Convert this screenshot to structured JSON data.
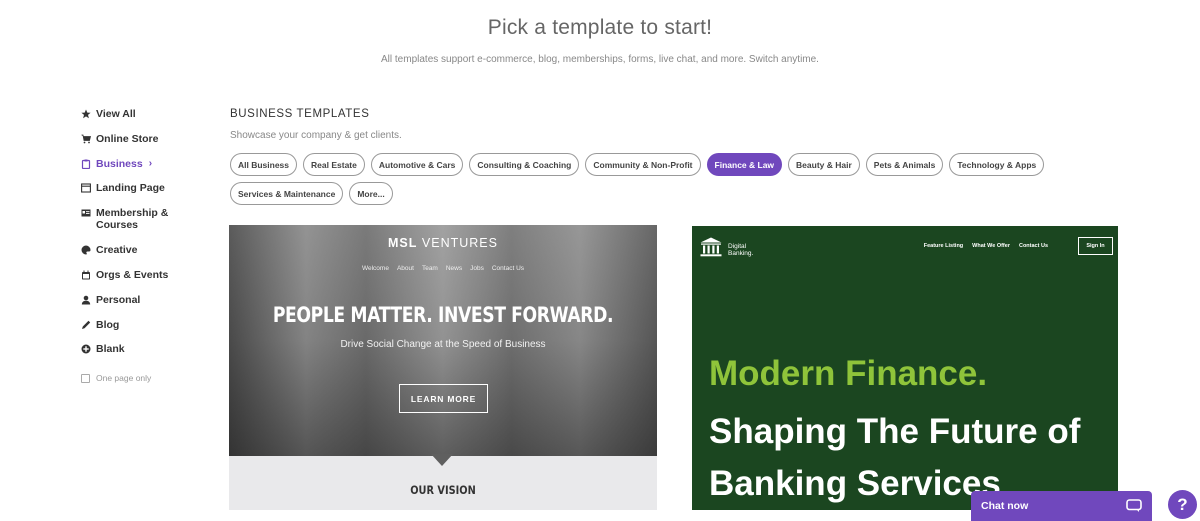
{
  "hero": {
    "title": "Pick a template to start!",
    "subtitle": "All templates support e-commerce, blog, memberships, forms, live chat, and more. Switch anytime."
  },
  "sidebar": {
    "items": [
      {
        "label": "View All",
        "icon": "star-icon"
      },
      {
        "label": "Online Store",
        "icon": "cart-icon"
      },
      {
        "label": "Business",
        "icon": "clipboard-icon",
        "active": true,
        "arrow": "›"
      },
      {
        "label": "Landing Page",
        "icon": "window-icon"
      },
      {
        "label": "Membership &",
        "label2": "Courses",
        "icon": "id-card-icon"
      },
      {
        "label": "Creative",
        "icon": "palette-icon"
      },
      {
        "label": "Orgs & Events",
        "icon": "calendar-icon"
      },
      {
        "label": "Personal",
        "icon": "person-icon"
      },
      {
        "label": "Blog",
        "icon": "pen-icon"
      },
      {
        "label": "Blank",
        "icon": "plus-circle-icon"
      }
    ],
    "one_page_label": "One page only",
    "active_color": "#7048bd"
  },
  "section": {
    "title": "BUSINESS TEMPLATES",
    "subtitle": "Showcase your company & get clients."
  },
  "chips": [
    {
      "label": "All Business"
    },
    {
      "label": "Real Estate"
    },
    {
      "label": "Automotive & Cars"
    },
    {
      "label": "Consulting & Coaching"
    },
    {
      "label": "Community & Non-Profit"
    },
    {
      "label": "Finance & Law",
      "active": true
    },
    {
      "label": "Beauty & Hair"
    },
    {
      "label": "Pets & Animals"
    },
    {
      "label": "Technology & Apps"
    },
    {
      "label": "Services & Maintenance"
    },
    {
      "label": "More..."
    }
  ],
  "template1": {
    "brand_bold": "MSL",
    "brand_rest": "VENTURES",
    "nav": [
      "Welcome",
      "About",
      "Team",
      "News",
      "Jobs",
      "Contact Us"
    ],
    "headline": "PEOPLE MATTER. INVEST FORWARD.",
    "tagline": "Drive Social Change at the Speed of Business",
    "button": "LEARN MORE",
    "vision": "OUR VISION"
  },
  "template2": {
    "logo_line1": "Digital",
    "logo_line2": "Banking.",
    "nav": [
      "Feature Listing",
      "What We Offer",
      "Contact Us"
    ],
    "signin": "Sign In",
    "headline1": "Modern Finance.",
    "headline2": "Shaping The Future of Banking Services",
    "bg_color": "#1b4620",
    "accent_color": "#8fc43a"
  },
  "chat": {
    "label": "Chat now"
  },
  "help": {
    "label": "?"
  }
}
